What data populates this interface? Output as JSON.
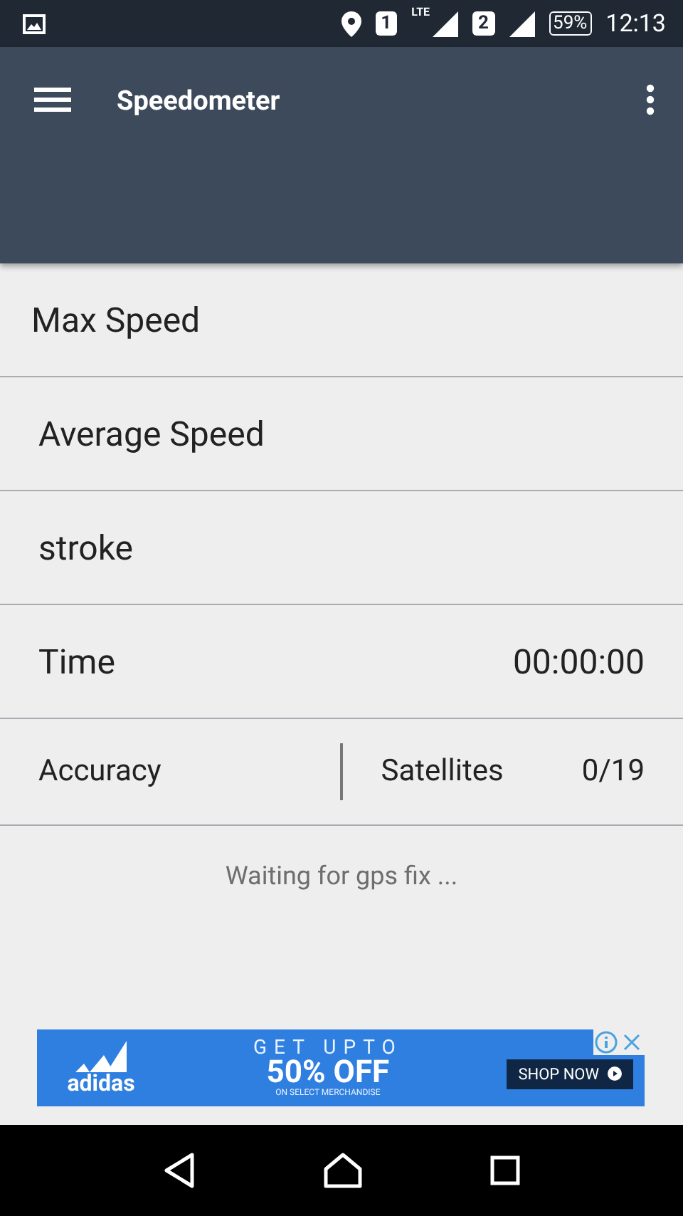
{
  "status_bar": {
    "sim_1": "1",
    "network_type": "LTE",
    "sim_2": "2",
    "battery": "59%",
    "time": "12:13"
  },
  "app_bar": {
    "title": "Speedometer"
  },
  "rows": [
    {
      "kind": "single",
      "label": "Max Speed"
    },
    {
      "kind": "single",
      "label": "Average Speed"
    },
    {
      "kind": "single",
      "label": "stroke"
    },
    {
      "kind": "value",
      "label": "Time",
      "value": "00:00:00"
    },
    {
      "kind": "split",
      "label": "Accuracy",
      "label_2": "Satellites",
      "value": "0/19"
    }
  ],
  "status_message": "Waiting for gps fix ...",
  "ad": {
    "brand": "adidas",
    "headline": "GET UPTO",
    "offer": "50% OFF",
    "subline": "ON SELECT MERCHANDISE",
    "cta": "SHOP NOW"
  }
}
